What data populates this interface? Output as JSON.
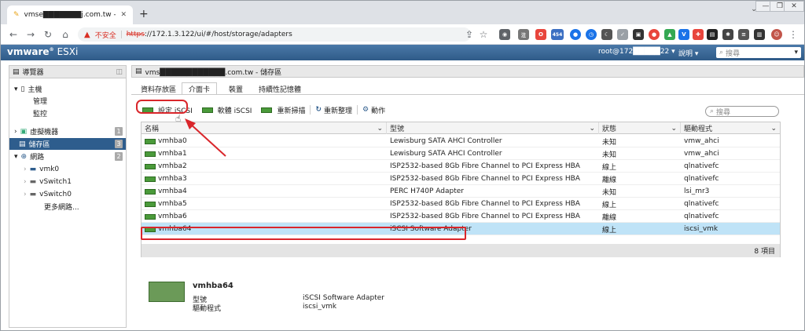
{
  "browser": {
    "tab_title": "vmse███████j.com.tw - VM",
    "new_tab": "+",
    "not_secure": "不安全",
    "url_scheme": "https",
    "url_rest": "://172.1.3.122/ui/#/host/storage/adapters",
    "ext_badge": "454"
  },
  "vmware": {
    "brand": "vmware",
    "product": "ESXi",
    "user": "root@172█████22 ▾",
    "help": "說明 ▾",
    "search_placeholder": "搜尋"
  },
  "navigator": {
    "title": "導覽器",
    "items": [
      {
        "label": "主機",
        "badge": ""
      },
      {
        "label": "管理",
        "badge": ""
      },
      {
        "label": "監控",
        "badge": ""
      },
      {
        "label": "虛擬機器",
        "badge": "1"
      },
      {
        "label": "儲存區",
        "badge": "3"
      },
      {
        "label": "網路",
        "badge": "2"
      },
      {
        "label": "vmk0",
        "badge": ""
      },
      {
        "label": "vSwitch1",
        "badge": ""
      },
      {
        "label": "vSwitch0",
        "badge": ""
      },
      {
        "label": "更多網路...",
        "badge": ""
      }
    ]
  },
  "main": {
    "title": "vms████████████.com.tw - 儲存區",
    "tabs": [
      "資料存放區",
      "介面卡",
      "裝置",
      "持續性記憶體"
    ],
    "toolbar": {
      "config_iscsi": "設定 iSCSI",
      "software_iscsi": "軟體 iSCSI",
      "rescan": "重新掃描",
      "refresh": "重新整理",
      "actions": "動作"
    },
    "search_placeholder": "搜尋",
    "table": {
      "headers": [
        "名稱",
        "型號",
        "狀態",
        "驅動程式"
      ],
      "rows": [
        {
          "name": "vmhba0",
          "model": "Lewisburg SATA AHCI Controller",
          "status": "未知",
          "driver": "vmw_ahci"
        },
        {
          "name": "vmhba1",
          "model": "Lewisburg SATA AHCI Controller",
          "status": "未知",
          "driver": "vmw_ahci"
        },
        {
          "name": "vmhba2",
          "model": "ISP2532-based 8Gb Fibre Channel to PCI Express HBA",
          "status": "線上",
          "driver": "qlnativefc"
        },
        {
          "name": "vmhba3",
          "model": "ISP2532-based 8Gb Fibre Channel to PCI Express HBA",
          "status": "離線",
          "driver": "qlnativefc"
        },
        {
          "name": "vmhba4",
          "model": "PERC H740P Adapter",
          "status": "未知",
          "driver": "lsi_mr3"
        },
        {
          "name": "vmhba5",
          "model": "ISP2532-based 8Gb Fibre Channel to PCI Express HBA",
          "status": "線上",
          "driver": "qlnativefc"
        },
        {
          "name": "vmhba6",
          "model": "ISP2532-based 8Gb Fibre Channel to PCI Express HBA",
          "status": "離線",
          "driver": "qlnativefc"
        },
        {
          "name": "vmhba64",
          "model": "iSCSI Software Adapter",
          "status": "線上",
          "driver": "iscsi_vmk"
        }
      ],
      "footer": "8 項目"
    },
    "details": {
      "name": "vmhba64",
      "model_label": "型號",
      "model_value": "iSCSI Software Adapter",
      "driver_label": "驅動程式",
      "driver_value": "iscsi_vmk"
    }
  },
  "colors": {
    "header": "#2f5b88",
    "selected_row": "#bfe3f7",
    "annotation": "#d9262b"
  }
}
